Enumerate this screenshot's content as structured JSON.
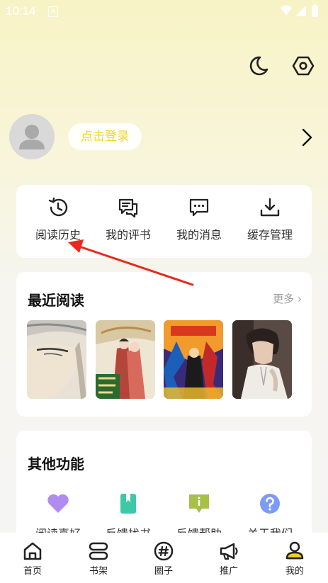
{
  "status_bar": {
    "time": "10:14",
    "app_indicator": "A"
  },
  "header": {
    "theme_toggle_icon": "moon-icon",
    "settings_icon": "hexagon-settings-icon"
  },
  "profile": {
    "login_label": "点击登录",
    "accent_color": "#f3d61b"
  },
  "quick_actions": [
    {
      "label": "阅读历史",
      "icon": "history-icon"
    },
    {
      "label": "我的评书",
      "icon": "comment-icon"
    },
    {
      "label": "我的消息",
      "icon": "message-icon"
    },
    {
      "label": "缓存管理",
      "icon": "download-icon"
    }
  ],
  "recent": {
    "title": "最近阅读",
    "more_label": "更多"
  },
  "other": {
    "title": "其他功能",
    "items": [
      {
        "label": "阅读喜好",
        "icon": "heart-icon",
        "color": "#b18cf0"
      },
      {
        "label": "反馈找书",
        "icon": "bookmark-icon",
        "color": "#3dc9a8"
      },
      {
        "label": "反馈帮助",
        "icon": "info-icon",
        "color": "#a7c04a"
      },
      {
        "label": "关于我们",
        "icon": "question-icon",
        "color": "#7d9af7"
      }
    ]
  },
  "tabs": [
    {
      "label": "首页",
      "icon": "home-icon"
    },
    {
      "label": "书架",
      "icon": "bookshelf-icon"
    },
    {
      "label": "圈子",
      "icon": "hashtag-icon"
    },
    {
      "label": "推广",
      "icon": "megaphone-icon"
    },
    {
      "label": "我的",
      "icon": "profile-icon",
      "active": true
    }
  ]
}
